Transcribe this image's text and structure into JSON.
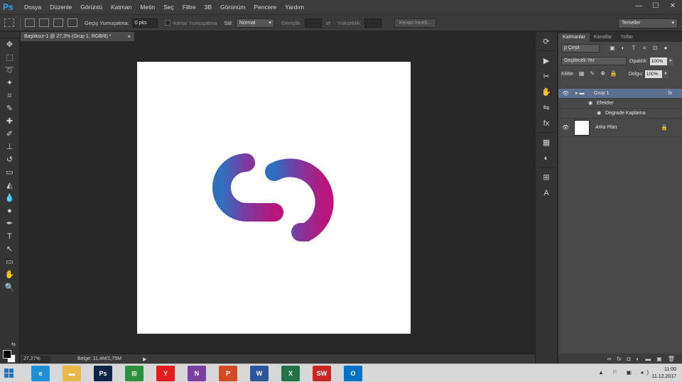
{
  "app": {
    "logo": "Ps",
    "menu": [
      "Dosya",
      "Düzenle",
      "Görüntü",
      "Katman",
      "Metin",
      "Seç",
      "Filtre",
      "3B",
      "Görünüm",
      "Pencere",
      "Yardım"
    ],
    "window_controls": {
      "minimize": "—",
      "maximize": "☐",
      "close": "✕"
    }
  },
  "options": {
    "feather_label": "Geçiş Yumuşatma:",
    "feather_value": "0 pks",
    "antialias_label": "Kenar Yumuşatma",
    "style_label": "Stil:",
    "style_value": "Normal",
    "width_label": "Genişlik:",
    "height_label": "Yükseklik:",
    "swap_icon": "⇄",
    "refine_edge": "Kenarı İncelt...",
    "workspace": "Temeller"
  },
  "tools": [
    {
      "name": "move-tool",
      "glyph": "✥"
    },
    {
      "name": "marquee-tool",
      "glyph": "⬚"
    },
    {
      "name": "lasso-tool",
      "glyph": "➰"
    },
    {
      "name": "quick-select-tool",
      "glyph": "✦"
    },
    {
      "name": "crop-tool",
      "glyph": "⌗"
    },
    {
      "name": "eyedropper-tool",
      "glyph": "✎"
    },
    {
      "name": "healing-brush-tool",
      "glyph": "✚"
    },
    {
      "name": "brush-tool",
      "glyph": "✐"
    },
    {
      "name": "clone-stamp-tool",
      "glyph": "⊥"
    },
    {
      "name": "history-brush-tool",
      "glyph": "↺"
    },
    {
      "name": "eraser-tool",
      "glyph": "▭"
    },
    {
      "name": "paint-bucket-tool",
      "glyph": "◭"
    },
    {
      "name": "blur-tool",
      "glyph": "💧"
    },
    {
      "name": "dodge-tool",
      "glyph": "●"
    },
    {
      "name": "pen-tool",
      "glyph": "✒"
    },
    {
      "name": "type-tool",
      "glyph": "T"
    },
    {
      "name": "path-selection-tool",
      "glyph": "↖"
    },
    {
      "name": "shape-tool",
      "glyph": "▭"
    },
    {
      "name": "hand-tool",
      "glyph": "✋"
    },
    {
      "name": "zoom-tool",
      "glyph": "🔍"
    }
  ],
  "extra_tool_glyphs": {
    "swap_colors": "⇆",
    "quick_mask": "◙",
    "screen_mode": "▣"
  },
  "document": {
    "tab_title": "Başlıksız-1 @ 27,3% (Grup 1, RGB/8) *",
    "close": "×",
    "zoom": "27,27%",
    "doc_info": "Belge: 11,4M/1,75M",
    "arrow": "▶"
  },
  "logo_colors": {
    "start": "#2f6fc0",
    "mid": "#7a3aa2",
    "end": "#b8167a"
  },
  "dock": [
    "⟳",
    "▶",
    "✂",
    "✋",
    "⇋",
    "fx",
    "▦",
    "◐",
    "⊞",
    "A"
  ],
  "layers_panel": {
    "tabs": [
      "Katmanlar",
      "Kanallar",
      "Yollar"
    ],
    "filter": "ρ Çeşit",
    "filter_icons": [
      "▣",
      "◐",
      "T",
      "⌗",
      "⊡",
      "●"
    ],
    "blend_mode": "Geçilecek Yer",
    "opacity_label": "Opaklık:",
    "opacity_value": "100%",
    "lock_label": "Kilitle:",
    "lock_icons": [
      "▦",
      "✎",
      "✥",
      "🔒"
    ],
    "fill_label": "Dolgu:",
    "fill_value": "100%",
    "layers": [
      {
        "name": "Grup 1",
        "fx": "fx"
      },
      {
        "name": "Efektler"
      },
      {
        "name": "Degrade Kaplama"
      },
      {
        "name": "Arka Plan",
        "lock": "🔒"
      }
    ],
    "eye": "👁",
    "folder": "▸ ▬",
    "footer_icons": [
      "∞",
      "fx",
      "◘",
      "◐",
      "▬",
      "▣",
      "🗑"
    ]
  },
  "taskbar": {
    "apps": [
      {
        "name": "ie-icon",
        "label": "e",
        "color": "#1f8fd6"
      },
      {
        "name": "explorer-icon",
        "label": "▬",
        "color": "#e8b84a"
      },
      {
        "name": "photoshop-icon",
        "label": "Ps",
        "color": "#0b2646"
      },
      {
        "name": "store-icon",
        "label": "⊞",
        "color": "#2b8f3b"
      },
      {
        "name": "yandex-icon",
        "label": "Y",
        "color": "#e41c1c"
      },
      {
        "name": "onenote-icon",
        "label": "N",
        "color": "#7b3fa0"
      },
      {
        "name": "powerpoint-icon",
        "label": "P",
        "color": "#d34a24"
      },
      {
        "name": "word-icon",
        "label": "W",
        "color": "#2b579a"
      },
      {
        "name": "excel-icon",
        "label": "X",
        "color": "#217346"
      },
      {
        "name": "swf-icon",
        "label": "SW",
        "color": "#c8261e"
      },
      {
        "name": "outlook-icon",
        "label": "O",
        "color": "#0072c6"
      }
    ],
    "tray": "▲ ⚐ ▣ ◂)",
    "time": "11:00",
    "date": "11.12.2017"
  }
}
